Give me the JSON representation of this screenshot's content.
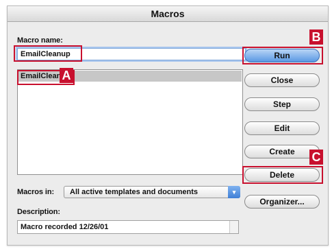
{
  "window": {
    "title": "Macros"
  },
  "macro_name": {
    "label": "Macro name:",
    "value": "EmailCleanup"
  },
  "macro_list": {
    "items": [
      "EmailCleanup"
    ]
  },
  "buttons": {
    "run": "Run",
    "close": "Close",
    "step": "Step",
    "edit": "Edit",
    "create": "Create",
    "delete": "Delete",
    "organizer": "Organizer..."
  },
  "macros_in": {
    "label": "Macros in:",
    "selected": "All active templates and documents"
  },
  "description": {
    "label": "Description:",
    "value": "Macro recorded 12/26/01"
  },
  "callouts": {
    "a": "A",
    "b": "B",
    "c": "C"
  },
  "colors": {
    "callout": "#c8102e",
    "focus_ring": "#a9c6ee",
    "primary_button": "#5a98e3"
  }
}
